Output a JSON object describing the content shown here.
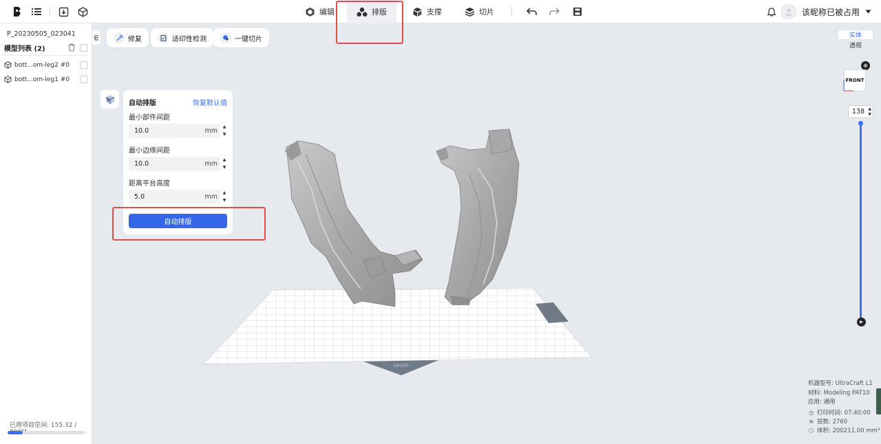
{
  "topbar": {
    "tabs": [
      {
        "label": "编辑",
        "icon": "edit-cube-icon"
      },
      {
        "label": "排版",
        "icon": "arrange-spheres-icon",
        "active": true
      },
      {
        "label": "支撑",
        "icon": "support-icon"
      },
      {
        "label": "切片",
        "icon": "slice-layers-icon"
      }
    ],
    "user_name": "该昵称已被占用"
  },
  "sidebar": {
    "project_name": "P_20230505_023041",
    "model_list_title": "模型列表 (2)",
    "models": [
      {
        "name": "bott...om-leg2 #0"
      },
      {
        "name": "bott...om-leg1 #0"
      }
    ],
    "space_label": "已用项目空间: 155.32 / 800M",
    "space_fraction": 0.194
  },
  "toolbar": {
    "repair_label": "修复",
    "printability_label": "适印性检测",
    "one_click_slice_label": "一键切片"
  },
  "arrange_panel": {
    "title": "自动排版",
    "reset_label": "恢复默认值",
    "fields": [
      {
        "label": "最小部件间距",
        "value": "10.0",
        "unit": "mm"
      },
      {
        "label": "最小边缘间距",
        "value": "10.0",
        "unit": "mm"
      },
      {
        "label": "距离平台高度",
        "value": "5.0",
        "unit": "mm"
      }
    ],
    "button_label": "自动排版"
  },
  "viewport": {
    "view_solid": "实体",
    "view_perspective": "透视",
    "cube_label": "FRONT",
    "platform_label": "FRONT",
    "layer_value": "138"
  },
  "info": {
    "machine": "机器型号: UltraCraft L1",
    "material": "材料: Modeling PAT10",
    "application": "应用: 通用",
    "print_time": "打印时间: 07:40:00",
    "layers": "层数: 2760",
    "volume": "体积: 200211.00 mm³"
  },
  "colors": {
    "accent": "#3a6ff2",
    "highlight_box": "#e14b4b",
    "viewport_bg": "#e6e9ee"
  }
}
